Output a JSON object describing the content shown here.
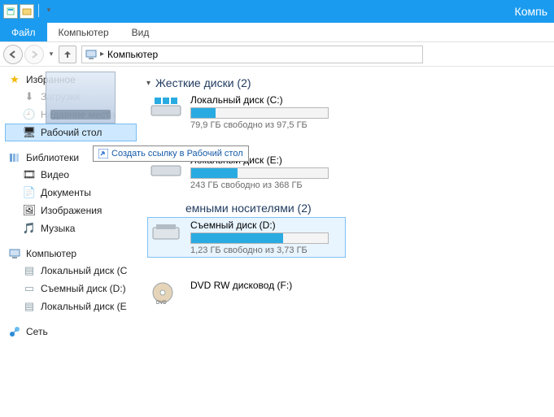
{
  "titlebar": {
    "title": "Компь"
  },
  "ribbon": {
    "file": "Файл",
    "tabs": [
      "Компьютер",
      "Вид"
    ]
  },
  "breadcrumb": {
    "location": "Компьютер"
  },
  "sidebar": {
    "favorites": {
      "head": "Избранное",
      "items": [
        "Загрузки",
        "Недавние места",
        "Рабочий стол"
      ],
      "selected": 2
    },
    "libraries": {
      "head": "Библиотеки",
      "items": [
        "Видео",
        "Документы",
        "Изображения",
        "Музыка"
      ]
    },
    "computer": {
      "head": "Компьютер",
      "items": [
        "Локальный диск (C",
        "Съемный диск (D:)",
        "Локальный диск (E"
      ]
    },
    "network": {
      "head": "Сеть"
    }
  },
  "drop_hint": "Создать ссылку в Рабочий стол",
  "sections": {
    "hard": {
      "title": "Жесткие диски (2)"
    },
    "removable": {
      "title": "емными носителями (2)"
    }
  },
  "disks": {
    "c": {
      "title": "Локальный диск (C:)",
      "sub": "79,9 ГБ свободно из 97,5 ГБ",
      "fill": 18
    },
    "e": {
      "title": "Локальный диск (E:)",
      "sub": "243 ГБ свободно из 368 ГБ",
      "fill": 34
    },
    "d": {
      "title": "Съемный диск (D:)",
      "sub": "1,23 ГБ свободно из 3,73 ГБ",
      "fill": 67
    },
    "dvd": {
      "title": "DVD RW дисковод (F:)"
    }
  }
}
